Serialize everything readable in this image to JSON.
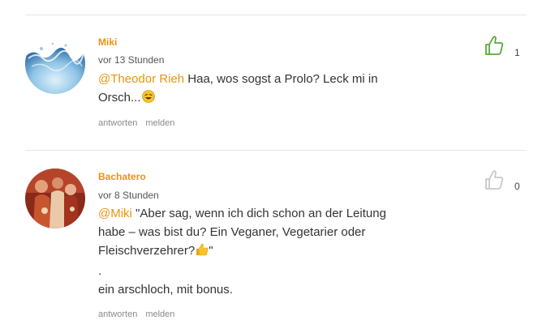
{
  "comments": [
    {
      "author": "Miki",
      "time": "vor 13 Stunden",
      "mention": "@Theodor Rieh",
      "text_line1": " Haa, wos sogst a Prolo? Leck mi in",
      "text_line2": "Orsch...",
      "emoji": "laughing-tears-emoji",
      "reply_label": "antworten",
      "report_label": "melden",
      "like_count": "1",
      "like_color": "#5aa83a"
    },
    {
      "author": "Bachatero",
      "time": "vor 8 Stunden",
      "mention": "@Miki",
      "text_line1": " \"Aber sag, wenn ich dich schon an der Leitung",
      "text_line2": "habe – was bist du? Ein Veganer, Vegetarier oder",
      "text_line3": "Fleischverzehrer?",
      "text_line3_end": "\"",
      "emoji": "thumbs-up-emoji",
      "text_line4": ".",
      "text_line5": "ein arschloch, mit bonus.",
      "reply_label": "antworten",
      "report_label": "melden",
      "like_count": "0",
      "like_color": "#c8c8c8"
    }
  ],
  "colors": {
    "accent": "#e8940f",
    "divider": "#e6e6e6"
  }
}
